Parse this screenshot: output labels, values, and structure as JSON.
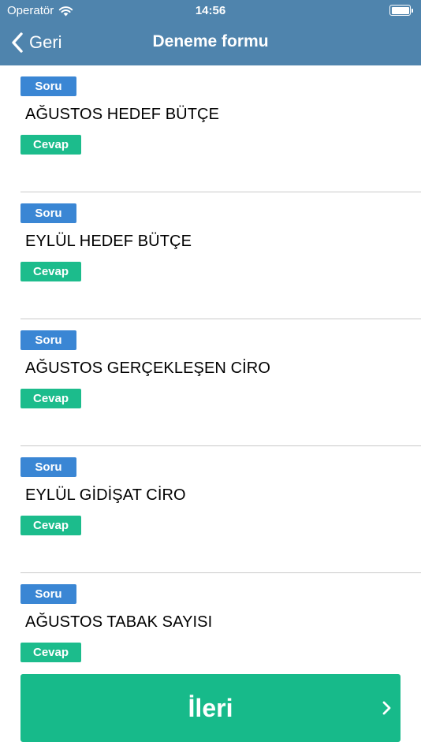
{
  "status_bar": {
    "carrier": "Operatör",
    "time": "14:56"
  },
  "nav": {
    "back_label": "Geri",
    "title": "Deneme formu"
  },
  "questions": [
    {
      "tag": "Soru",
      "text": "AĞUSTOS HEDEF BÜTÇE",
      "answer_tag": "Cevap"
    },
    {
      "tag": "Soru",
      "text": "EYLÜL HEDEF BÜTÇE",
      "answer_tag": "Cevap"
    },
    {
      "tag": "Soru",
      "text": "AĞUSTOS GERÇEKLEŞEN CİRO",
      "answer_tag": "Cevap"
    },
    {
      "tag": "Soru",
      "text": "EYLÜL GİDİŞAT CİRO",
      "answer_tag": "Cevap"
    },
    {
      "tag": "Soru",
      "text": "AĞUSTOS TABAK SAYISI",
      "answer_tag": "Cevap"
    }
  ],
  "footer": {
    "next_label": "İleri"
  },
  "colors": {
    "header": "#4f84ad",
    "soru": "#3a86d4",
    "cevap": "#1cbc8c",
    "next": "#17ba8a"
  },
  "icons": {
    "back": "chevron-left-icon",
    "next": "chevron-right-icon",
    "wifi": "wifi-icon",
    "battery": "battery-icon"
  }
}
